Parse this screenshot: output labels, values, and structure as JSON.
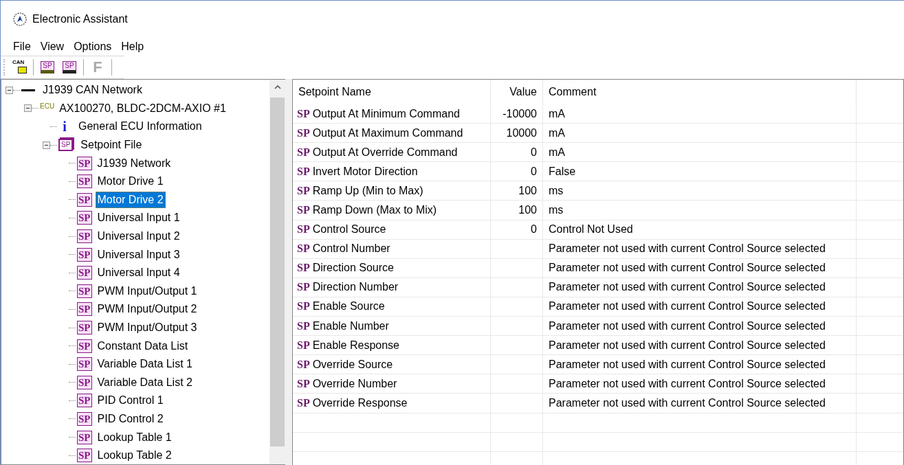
{
  "window": {
    "title": "Electronic Assistant"
  },
  "menu": [
    "File",
    "View",
    "Options",
    "Help"
  ],
  "toolbar": [
    {
      "kind": "can",
      "label": "CAN"
    },
    {
      "kind": "open",
      "label": "SP"
    },
    {
      "kind": "save",
      "label": "SP"
    },
    {
      "kind": "letter",
      "label": "F",
      "disabled": true
    }
  ],
  "tree": [
    {
      "label": "J1939 CAN Network",
      "kind": "network",
      "expanded": true,
      "selected": false,
      "children": [
        {
          "label": "AX100270, BLDC-2DCM-AXIO #1",
          "kind": "ecu",
          "icon_label": "ECU",
          "expanded": true,
          "selected": false,
          "children": [
            {
              "label": "General ECU Information",
              "kind": "info",
              "icon_label": "i",
              "selected": false
            },
            {
              "label": "Setpoint File",
              "kind": "setpoint-file",
              "icon_label": "SP",
              "expanded": true,
              "selected": false,
              "children": [
                {
                  "label": "J1939 Network",
                  "kind": "setpoint",
                  "icon_label": "SP",
                  "selected": false
                },
                {
                  "label": "Motor Drive 1",
                  "kind": "setpoint",
                  "icon_label": "SP",
                  "selected": false
                },
                {
                  "label": "Motor Drive 2",
                  "kind": "setpoint",
                  "icon_label": "SP",
                  "selected": true
                },
                {
                  "label": "Universal Input 1",
                  "kind": "setpoint",
                  "icon_label": "SP",
                  "selected": false
                },
                {
                  "label": "Universal Input 2",
                  "kind": "setpoint",
                  "icon_label": "SP",
                  "selected": false
                },
                {
                  "label": "Universal Input 3",
                  "kind": "setpoint",
                  "icon_label": "SP",
                  "selected": false
                },
                {
                  "label": "Universal Input 4",
                  "kind": "setpoint",
                  "icon_label": "SP",
                  "selected": false
                },
                {
                  "label": "PWM Input/Output 1",
                  "kind": "setpoint",
                  "icon_label": "SP",
                  "selected": false
                },
                {
                  "label": "PWM Input/Output 2",
                  "kind": "setpoint",
                  "icon_label": "SP",
                  "selected": false
                },
                {
                  "label": "PWM Input/Output 3",
                  "kind": "setpoint",
                  "icon_label": "SP",
                  "selected": false
                },
                {
                  "label": "Constant Data List",
                  "kind": "setpoint",
                  "icon_label": "SP",
                  "selected": false
                },
                {
                  "label": "Variable Data List 1",
                  "kind": "setpoint",
                  "icon_label": "SP",
                  "selected": false
                },
                {
                  "label": "Variable Data List 2",
                  "kind": "setpoint",
                  "icon_label": "SP",
                  "selected": false
                },
                {
                  "label": "PID Control 1",
                  "kind": "setpoint",
                  "icon_label": "SP",
                  "selected": false
                },
                {
                  "label": "PID Control 2",
                  "kind": "setpoint",
                  "icon_label": "SP",
                  "selected": false
                },
                {
                  "label": "Lookup Table 1",
                  "kind": "setpoint",
                  "icon_label": "SP",
                  "selected": false
                },
                {
                  "label": "Lookup Table 2",
                  "kind": "setpoint",
                  "icon_label": "SP",
                  "selected": false
                }
              ]
            }
          ]
        }
      ]
    }
  ],
  "table": {
    "columns": [
      "Setpoint Name",
      "Value",
      "Comment"
    ],
    "rows": [
      {
        "icon_label": "SP",
        "name": "Output At Minimum Command",
        "value": "-10000",
        "comment": "mA"
      },
      {
        "icon_label": "SP",
        "name": "Output At Maximum Command",
        "value": "10000",
        "comment": "mA"
      },
      {
        "icon_label": "SP",
        "name": "Output At Override Command",
        "value": "0",
        "comment": "mA"
      },
      {
        "icon_label": "SP",
        "name": "Invert Motor Direction",
        "value": "0",
        "comment": "False"
      },
      {
        "icon_label": "SP",
        "name": "Ramp Up (Min to Max)",
        "value": "100",
        "comment": "ms"
      },
      {
        "icon_label": "SP",
        "name": "Ramp Down (Max to Mix)",
        "value": "100",
        "comment": "ms"
      },
      {
        "icon_label": "SP",
        "name": "Control Source",
        "value": "0",
        "comment": "Control Not Used"
      },
      {
        "icon_label": "SP",
        "name": "Control Number",
        "comment": "Parameter not used with current Control Source selected"
      },
      {
        "icon_label": "SP",
        "name": "Direction Source",
        "comment": "Parameter not used with current Control Source selected"
      },
      {
        "icon_label": "SP",
        "name": "Direction Number",
        "comment": "Parameter not used with current Control Source selected"
      },
      {
        "icon_label": "SP",
        "name": "Enable Source",
        "comment": "Parameter not used with current Control Source selected"
      },
      {
        "icon_label": "SP",
        "name": "Enable Number",
        "comment": "Parameter not used with current Control Source selected"
      },
      {
        "icon_label": "SP",
        "name": "Enable Response",
        "comment": "Parameter not used with current Control Source selected"
      },
      {
        "icon_label": "SP",
        "name": "Override Source",
        "comment": "Parameter not used with current Control Source selected"
      },
      {
        "icon_label": "SP",
        "name": "Override Number",
        "comment": "Parameter not used with current Control Source selected"
      },
      {
        "icon_label": "SP",
        "name": "Override Response",
        "comment": "Parameter not used with current Control Source selected"
      }
    ]
  }
}
